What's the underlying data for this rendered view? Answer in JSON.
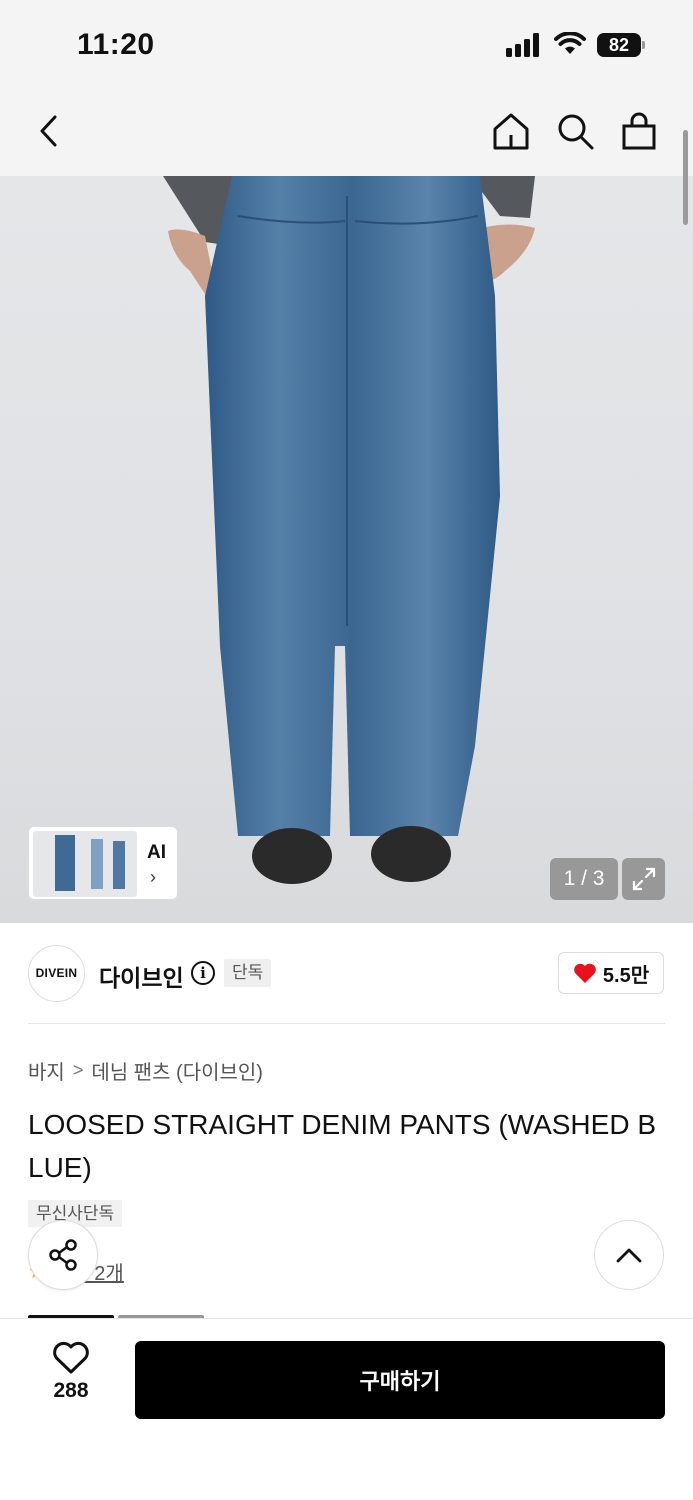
{
  "status_bar": {
    "time": "11:20",
    "battery": "82"
  },
  "nav": {
    "back_icon": "chevron-left-icon",
    "home_icon": "home-icon",
    "search_icon": "search-icon",
    "cart_icon": "shopping-bag-icon"
  },
  "gallery": {
    "ai_label": "AI",
    "chevron": "›",
    "counter": "1 / 3",
    "expand_icon": "expand-icon"
  },
  "brand": {
    "logo_text": "DIVEIN",
    "name": "다이브인",
    "info_icon": "i",
    "badge": "단독",
    "likes": "5.5만"
  },
  "breadcrumb": {
    "items": [
      "바지",
      "데님 팬츠 (다이브인)"
    ],
    "separator": ">"
  },
  "product": {
    "title": "LOOSED STRAIGHT DENIM PANTS (WASHED BLUE)",
    "tag": "무신사단독",
    "review_text": "후기 2개"
  },
  "bottom_bar": {
    "wish_count": "288",
    "buy_label": "구매하기"
  },
  "colors": {
    "accent": "#000000",
    "heart": "#e8121f",
    "denim": "#3f6a96"
  }
}
